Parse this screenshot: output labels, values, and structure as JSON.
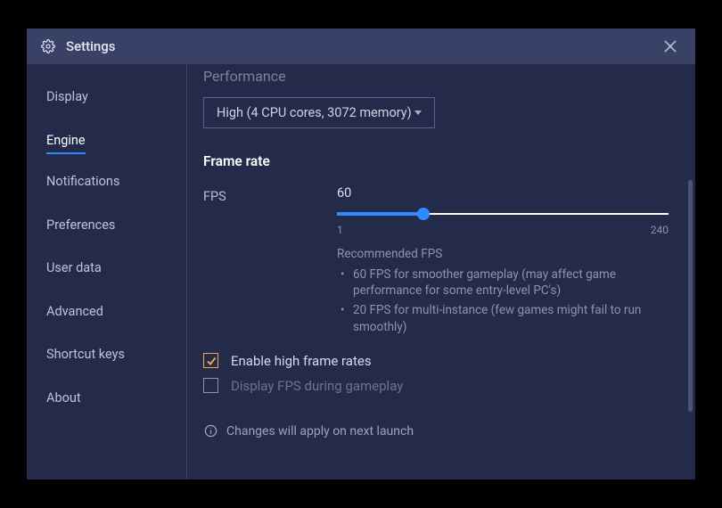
{
  "title": "Settings",
  "sidebar": {
    "items": [
      {
        "label": "Display",
        "active": false
      },
      {
        "label": "Engine",
        "active": true
      },
      {
        "label": "Notifications",
        "active": false
      },
      {
        "label": "Preferences",
        "active": false
      },
      {
        "label": "User data",
        "active": false
      },
      {
        "label": "Advanced",
        "active": false
      },
      {
        "label": "Shortcut keys",
        "active": false
      },
      {
        "label": "About",
        "active": false
      }
    ]
  },
  "content": {
    "performance": {
      "heading": "Performance",
      "selected": "High (4 CPU cores, 3072 memory)"
    },
    "frame_rate": {
      "heading": "Frame rate",
      "fps_label": "FPS",
      "fps_value": "60",
      "min": "1",
      "max": "240",
      "rec_title": "Recommended FPS",
      "rec_items": [
        "60 FPS for smoother gameplay (may affect game performance for some entry-level PC's)",
        "20 FPS for multi-instance (few games might fail to run smoothly)"
      ]
    },
    "checkboxes": {
      "enable_high": {
        "label": "Enable high frame rates",
        "checked": true
      },
      "display_fps": {
        "label": "Display FPS during gameplay",
        "checked": false
      }
    },
    "notice": "Changes will apply on next launch"
  }
}
